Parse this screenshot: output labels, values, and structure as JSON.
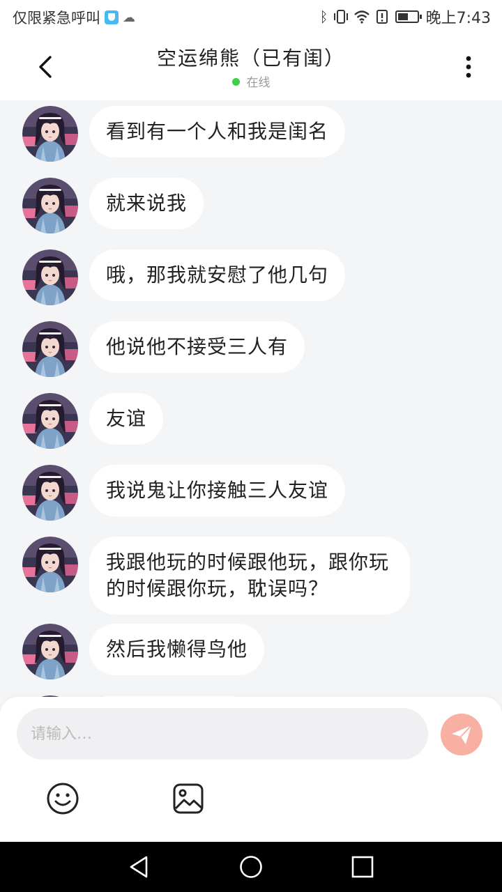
{
  "status_bar": {
    "left_text": "仅限紧急呼叫",
    "time": "晚上7:43"
  },
  "header": {
    "title": "空运绵熊（已有闺）",
    "status": "在线"
  },
  "messages": [
    "看到有一个人和我是闺名",
    "就来说我",
    "哦，那我就安慰了他几句",
    "他说他不接受三人有",
    "友谊",
    "我说鬼让你接触三人友谊",
    "我跟他玩的时候跟他玩，跟你玩的时候跟你玩，耽误吗？",
    "然后我懒得鸟他"
  ],
  "composer": {
    "placeholder": "请输入…"
  },
  "colors": {
    "online_dot": "#3fcf4a",
    "send_button": "#f7b0a2",
    "background": "#f4f5f7"
  },
  "icons": {
    "back": "chevron-left-icon",
    "more": "vertical-dots-icon",
    "send": "paper-plane-icon",
    "emoji": "smiley-icon",
    "image": "picture-icon"
  }
}
